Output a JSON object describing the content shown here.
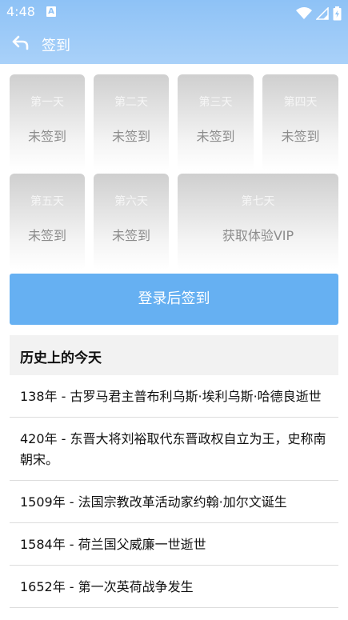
{
  "status_bar": {
    "time": "4:48",
    "notification_letter": "A"
  },
  "nav": {
    "title": "签到"
  },
  "days": [
    {
      "day": "第一天",
      "status": "未签到"
    },
    {
      "day": "第二天",
      "status": "未签到"
    },
    {
      "day": "第三天",
      "status": "未签到"
    },
    {
      "day": "第四天",
      "status": "未签到"
    },
    {
      "day": "第五天",
      "status": "未签到"
    },
    {
      "day": "第六天",
      "status": "未签到"
    },
    {
      "day": "第七天",
      "status": "获取体验VIP"
    }
  ],
  "signin_button": {
    "label": "登录后签到"
  },
  "history": {
    "title": "历史上的今天",
    "items": [
      "138年 - 古罗马君主普布利乌斯·埃利乌斯·哈德良逝世",
      "420年 - 东晋大将刘裕取代东晋政权自立为王，史称南朝宋。",
      "1509年 - 法国宗教改革活动家约翰·加尔文诞生",
      "1584年 - 荷兰国父威廉一世逝世",
      "1652年 - 第一次英荷战争发生"
    ]
  },
  "colors": {
    "header": "#8ec2f6",
    "button": "#66b0f2",
    "card_top": "#cfcfcf",
    "section_bg": "#f2f2f2"
  }
}
